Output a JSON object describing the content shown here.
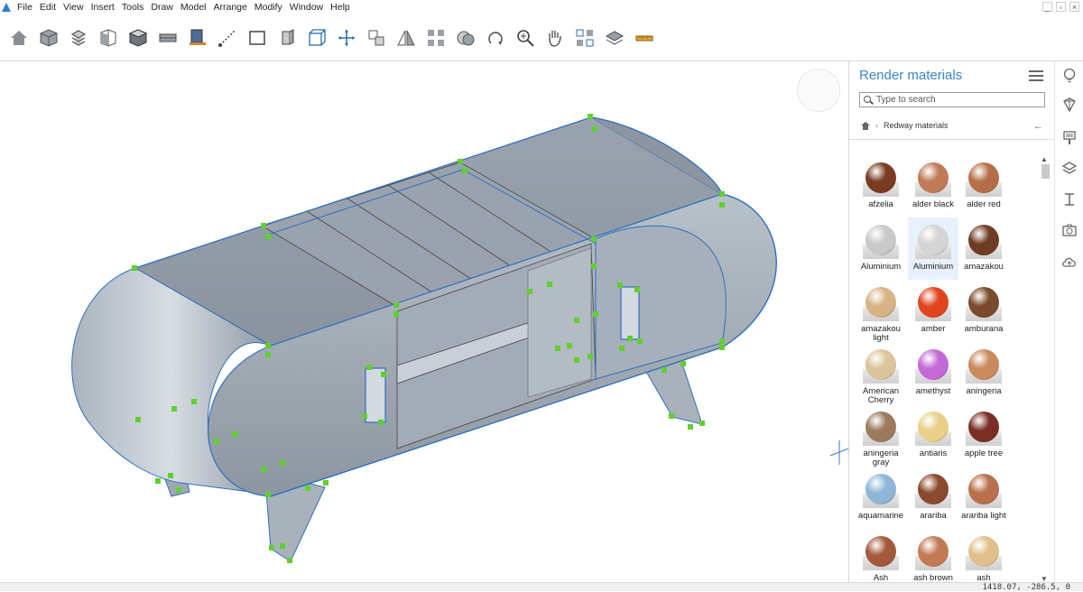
{
  "menu": {
    "items": [
      "File",
      "Edit",
      "View",
      "Insert",
      "Tools",
      "Draw",
      "Model",
      "Arrange",
      "Modify",
      "Window",
      "Help"
    ]
  },
  "window_controls": [
    "_",
    "▫",
    "×"
  ],
  "toolbar": {
    "tools": [
      "home-icon",
      "cube-shaded-icon",
      "cube-layers-icon",
      "cube-open-icon",
      "cube-solid-icon",
      "panel-icon",
      "frame-pencil-icon",
      "line-icon",
      "rectangle-icon",
      "extrude-icon",
      "box-3d-icon",
      "move-icon",
      "copy-icon",
      "mirror-icon",
      "array-icon",
      "combine-icon",
      "rotate-icon",
      "zoom-icon",
      "pan-icon",
      "group-icon",
      "layer-icon",
      "ruler-icon"
    ]
  },
  "panel": {
    "title": "Render materials",
    "search_placeholder": "Type to search",
    "breadcrumb": "Redway materials",
    "materials": [
      {
        "name": "afzelia",
        "color": "#7a3c22"
      },
      {
        "name": "alder black",
        "color": "#c07a55"
      },
      {
        "name": "alder red",
        "color": "#b66e48"
      },
      {
        "name": "Aluminium",
        "color": "#c9c9c9"
      },
      {
        "name": "Aluminium",
        "color": "#d4d4d4"
      },
      {
        "name": "amazakou",
        "color": "#6e3c25"
      },
      {
        "name": "amazakou light",
        "color": "#d6b384"
      },
      {
        "name": "amber",
        "color": "#e0451f"
      },
      {
        "name": "amburana",
        "color": "#7a4a2c"
      },
      {
        "name": "American Cherry",
        "color": "#dcc49a"
      },
      {
        "name": "amethyst",
        "color": "#c36ad6"
      },
      {
        "name": "aningeria",
        "color": "#c98a5f"
      },
      {
        "name": "aningeria gray",
        "color": "#9c7a5e"
      },
      {
        "name": "antiaris",
        "color": "#e8cf8a"
      },
      {
        "name": "apple tree",
        "color": "#7a2f25"
      },
      {
        "name": "aquamarine",
        "color": "#8fb6d6"
      },
      {
        "name": "arariba",
        "color": "#8a4a2e"
      },
      {
        "name": "arariba light",
        "color": "#b9704b"
      },
      {
        "name": "Ash",
        "color": "#a35a3c"
      },
      {
        "name": "ash brown",
        "color": "#c27a55"
      },
      {
        "name": "ash",
        "color": "#e1c08c"
      }
    ],
    "selected_index": 4
  },
  "status": {
    "coords": "1418.07, -286.5, 0"
  },
  "right_sidebar": {
    "icons": [
      "lightbulb-icon",
      "shield-diamond-icon",
      "paint-brush-icon",
      "layers-icon",
      "beam-icon",
      "camera-icon",
      "cloud-upload-icon"
    ]
  }
}
